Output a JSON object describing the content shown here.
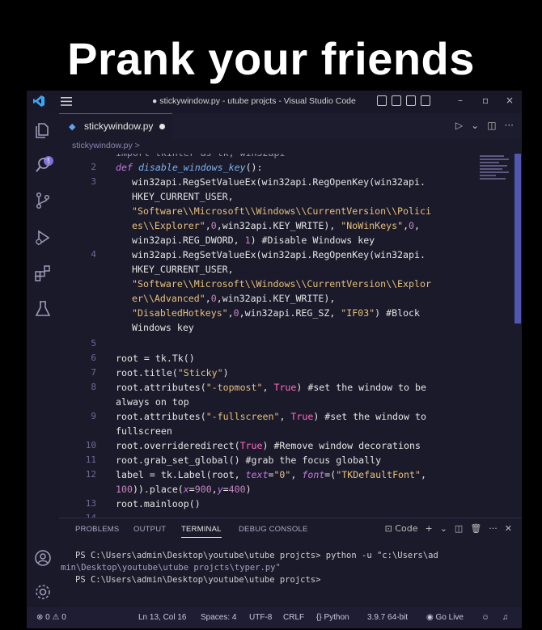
{
  "caption": "Prank your friends",
  "titlebar": {
    "title": "● stickywindow.py - utube projcts - Visual Studio Code",
    "minimize": "–",
    "maximize": "▫",
    "close": "×"
  },
  "tab": {
    "icon_text": "🐍",
    "label": "stickywindow.py"
  },
  "breadcrumb": "stickywindow.py >",
  "editor": {
    "line_numbers": [
      "2",
      "3",
      "4",
      "5",
      "6",
      "7",
      "8",
      "9",
      "10",
      "11",
      "12",
      "13",
      "14"
    ]
  },
  "panel": {
    "tabs": [
      "PROBLEMS",
      "OUTPUT",
      "TERMINAL",
      "DEBUG CONSOLE"
    ],
    "active_tab": "TERMINAL",
    "terminal_selector": "Code",
    "terminal_lines": [
      "PS C:\\Users\\admin\\Desktop\\youtube\\utube projcts> python -u \"c:\\Users\\ad",
      "min\\Desktop\\youtube\\utube projcts\\typer.py\"",
      "PS C:\\Users\\admin\\Desktop\\youtube\\utube projcts>"
    ]
  },
  "statusbar": {
    "problems": "⊗ 0 ⚠ 0",
    "position": "Ln 13, Col 16",
    "spaces": "Spaces: 4",
    "encoding": "UTF-8",
    "eol": "CRLF",
    "language": "Python",
    "interpreter": "3.9.7 64-bit",
    "golive": "Go Live"
  }
}
